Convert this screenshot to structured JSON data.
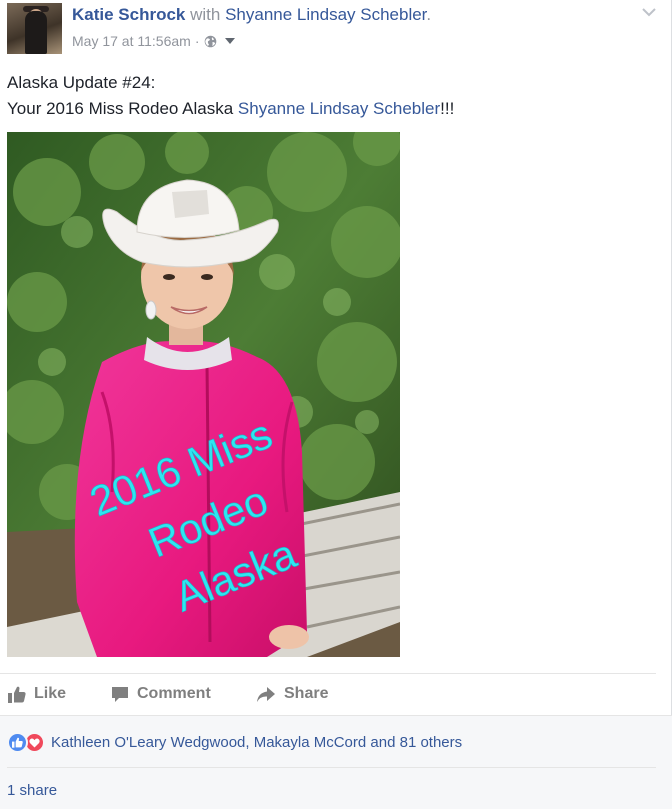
{
  "post": {
    "author": "Katie Schrock",
    "with_word": "with",
    "tagged_person": "Shyanne Lindsay Schebler",
    "tagged_suffix": ".",
    "timestamp": "May 17 at 11:56am",
    "separator": "·",
    "privacy_icon": "globe-icon",
    "text_line1": "Alaska Update #24:",
    "text_line2_prefix": "Your 2016 Miss Rodeo Alaska ",
    "text_line2_mention": "Shyanne Lindsay Schebler",
    "text_line2_suffix": "!!!",
    "photo_overlay": {
      "line1": "2016 Miss",
      "line2": "Rodeo",
      "line3": "Alaska",
      "color": "#2ee6f0"
    }
  },
  "actions": {
    "like_label": "Like",
    "comment_label": "Comment",
    "share_label": "Share"
  },
  "reactions": {
    "icons": [
      "like-reaction-icon",
      "love-reaction-icon"
    ],
    "people_text": "Kathleen O'Leary Wedgwood, Makayla McCord and 81 others",
    "shares_text": "1 share"
  },
  "colors": {
    "link_blue": "#365899",
    "meta_gray": "#90949c",
    "action_gray": "#7f7f7f",
    "like_blue": "#4f8bf0",
    "love_red": "#f0495c",
    "jacket_pink": "#e8197f"
  }
}
